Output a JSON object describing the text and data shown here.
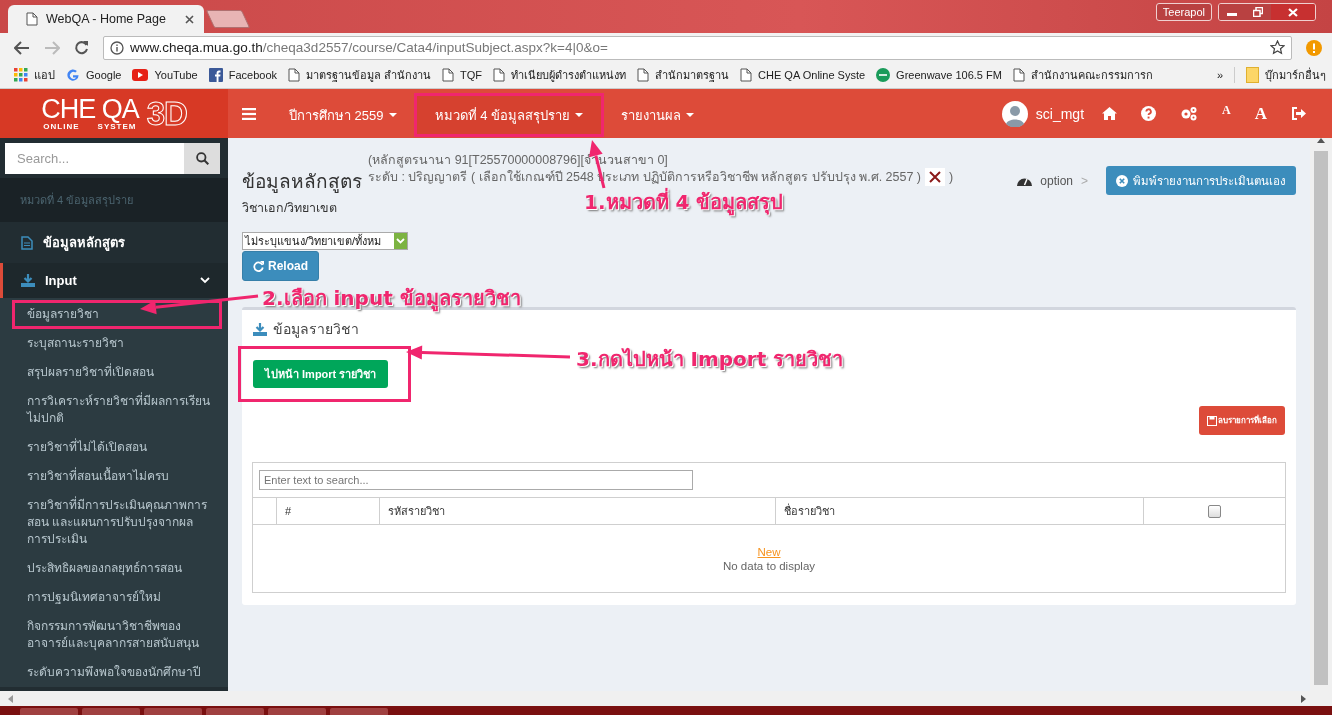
{
  "browser": {
    "tab_title": "WebQA - Home Page",
    "user_badge": "Teerapol",
    "url_host": "www.cheqa.mua.go.th",
    "url_path": "/cheqa3d2557/course/Cata4/inputSubject.aspx?k=4|0&o=",
    "bookmarks": [
      {
        "label": "แอป",
        "kind": "apps"
      },
      {
        "label": "Google",
        "kind": "google"
      },
      {
        "label": "YouTube",
        "kind": "youtube"
      },
      {
        "label": "Facebook",
        "kind": "facebook"
      },
      {
        "label": "มาตรฐานข้อมูล สำนักงาน",
        "kind": "page"
      },
      {
        "label": "TQF",
        "kind": "page"
      },
      {
        "label": "ทำเนียบผู้ดำรงตำแหน่งท",
        "kind": "page"
      },
      {
        "label": "สำนักมาตรฐาน",
        "kind": "page"
      },
      {
        "label": "CHE QA Online Syste",
        "kind": "page"
      },
      {
        "label": "Greenwave 106.5 FM",
        "kind": "radio"
      },
      {
        "label": "สำนักงานคณะกรรมการก",
        "kind": "page"
      }
    ],
    "overflow": "»",
    "other_bookmarks": "บุ๊กมาร์กอื่นๆ"
  },
  "app": {
    "logo": {
      "main": "CHE QA",
      "sub_left": "ONLINE",
      "sub_right": "SYSTEM",
      "suffix": "3D"
    },
    "nav": [
      {
        "label": "ปีการศึกษา 2559",
        "highlighted": false
      },
      {
        "label": "หมวดที่ 4 ข้อมูลสรุปราย",
        "highlighted": true
      },
      {
        "label": "รายงานผล",
        "highlighted": false
      }
    ],
    "user": "sci_mgt",
    "font_buttons": [
      {
        "label": "A",
        "kind": "small"
      },
      {
        "label": "A",
        "kind": "large"
      }
    ]
  },
  "sidebar": {
    "search_placeholder": "Search...",
    "section": "หมวดที่ 4 ข้อมูลสรุปราย",
    "items": [
      {
        "label": "ข้อมูลหลักสูตร",
        "kind": "page"
      },
      {
        "label": "Input",
        "kind": "group",
        "expanded": true,
        "children": [
          {
            "label": "ข้อมูลรายวิชา",
            "highlighted": true
          },
          {
            "label": "ระบุสถานะรายวิชา",
            "highlighted": false
          },
          {
            "label": "สรุปผลรายวิชาที่เปิดสอน",
            "highlighted": false
          },
          {
            "label": "การวิเคราะห์รายวิชาที่มีผลการเรียนไม่ปกติ",
            "highlighted": false
          },
          {
            "label": "รายวิชาที่ไม่ได้เปิดสอน",
            "highlighted": false
          },
          {
            "label": "รายวิชาที่สอนเนื้อหาไม่ครบ",
            "highlighted": false
          },
          {
            "label": "รายวิชาที่มีการประเมินคุณภาพการสอน และแผนการปรับปรุงจากผลการประเมิน",
            "highlighted": false
          },
          {
            "label": "ประสิทธิผลของกลยุทธ์การสอน",
            "highlighted": false
          },
          {
            "label": "การปฐมนิเทศอาจารย์ใหม่",
            "highlighted": false
          },
          {
            "label": "กิจกรรมการพัฒนาวิชาชีพของอาจารย์และบุคลากรสายสนับสนุน",
            "highlighted": false
          },
          {
            "label": "ระดับความพึงพอใจของนักศึกษาปี",
            "highlighted": false
          }
        ]
      }
    ]
  },
  "main": {
    "title": "ข้อมูลหลักสูตร",
    "info_line1": "(หลักสูตรนานา 91[T25570000008796][จำนวนสาขา 0]",
    "info_line2": "ระดับ : ปริญญาตรี ( เลือกใช้เกณฑ์ปี 2548 ประเภท ปฏิบัติการหรือวิชาชีพ หลักสูตร ปรับปรุง พ.ศ. 2557 )",
    "info_close": ")",
    "subtitle": "วิชาเอก/วิทยาเขต",
    "option": "option",
    "breadcrumb_sep": ">",
    "print_button": "พิมพ์รายงานการประเมินตนเอง",
    "campus_select": "ไม่ระบุแขนง/วิทยาเขต/ทั้งหม",
    "reload": "Reload",
    "panel": {
      "title": "ข้อมูลรายวิชา",
      "import_button": {
        "label": "ไปหน้า Import รายวิชา",
        "highlighted": true
      },
      "delete_button": "ลบรายการที่เลือก",
      "grid": {
        "search_placeholder": "Enter text to search...",
        "columns": [
          "#",
          "รหัสรายวิชา",
          "ชื่อรายวิชา"
        ],
        "select_all_checked": false,
        "new_link": "New",
        "empty": "No data to display"
      }
    }
  },
  "annotations": [
    {
      "text": "1.หมวดที่ 4 ข้อมูลสรุป"
    },
    {
      "text": "2.เลือก input ข้อมูลรายวิชา"
    },
    {
      "text": "3.กดไปหน้า Import รายวิชา"
    }
  ]
}
